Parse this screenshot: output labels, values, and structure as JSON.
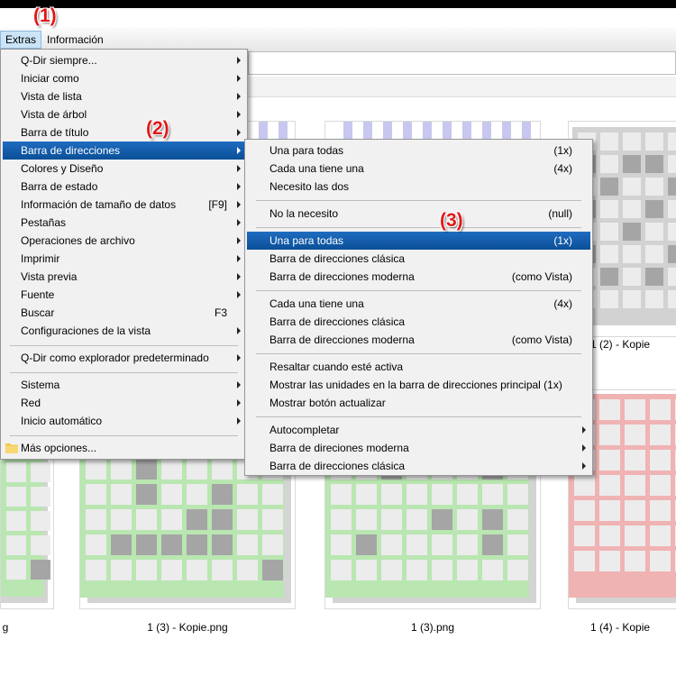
{
  "menubar": {
    "items": [
      {
        "label": "Extras"
      },
      {
        "label": "Información"
      }
    ]
  },
  "annotations": {
    "a1": "(1)",
    "a2": "(2)",
    "a3": "(3)"
  },
  "extras_menu": {
    "items": [
      {
        "label": "Q-Dir siempre...",
        "submenu": true
      },
      {
        "label": "Iniciar como",
        "submenu": true
      },
      {
        "label": "Vista de lista",
        "submenu": true
      },
      {
        "label": "Vista de árbol",
        "submenu": true
      },
      {
        "label": "Barra de título",
        "submenu": true
      },
      {
        "label": "Barra de direcciones",
        "submenu": true,
        "highlighted": true
      },
      {
        "label": "Colores y Diseño",
        "submenu": true
      },
      {
        "label": "Barra de estado",
        "submenu": true
      },
      {
        "label": "Información de tamaño de datos",
        "shortcut": "[F9]",
        "submenu": true
      },
      {
        "label": "Pestañas",
        "submenu": true
      },
      {
        "label": "Operaciones de archivo",
        "submenu": true
      },
      {
        "label": "Imprimir",
        "submenu": true
      },
      {
        "label": "Vista previa",
        "submenu": true
      },
      {
        "label": "Fuente",
        "submenu": true
      },
      {
        "label": "Buscar",
        "shortcut": "F3"
      },
      {
        "label": "Configuraciones de la vista",
        "submenu": true
      },
      {
        "label": "Q-Dir como explorador predeterminado",
        "submenu": true
      },
      {
        "label": "Sistema",
        "submenu": true
      },
      {
        "label": "Red",
        "submenu": true
      },
      {
        "label": "Inicio automático",
        "submenu": true
      },
      {
        "label": "Más opciones...",
        "icon": "folder-icon"
      }
    ]
  },
  "address_submenu": {
    "items": [
      {
        "label": "Una para todas",
        "shortcut": "(1x)"
      },
      {
        "label": "Cada una tiene una",
        "shortcut": "(4x)"
      },
      {
        "label": "Necesito las dos"
      },
      {
        "label": "No la necesito",
        "shortcut": "(null)"
      },
      {
        "label": "Una para todas",
        "shortcut": "(1x)",
        "highlighted": true
      },
      {
        "label": "Barra de direcciones clásica"
      },
      {
        "label": "Barra de direcciones moderna",
        "shortcut": "(como Vista)"
      },
      {
        "label": "Cada una tiene una",
        "shortcut": "(4x)"
      },
      {
        "label": "Barra de direcciones clásica"
      },
      {
        "label": "Barra de direcciones moderna",
        "shortcut": "(como Vista)"
      },
      {
        "label": "Resaltar cuando esté activa"
      },
      {
        "label": "Mostrar las unidades en la barra de direcciones principal (1x)"
      },
      {
        "label": "Mostrar botón actualizar"
      },
      {
        "label": "Autocompletar",
        "submenu": true
      },
      {
        "label": "Barra de direciones moderna",
        "submenu": true
      },
      {
        "label": "Barra de direcciones clásica",
        "submenu": true
      }
    ]
  },
  "files": {
    "captions": [
      "1 (2) - Kopie",
      "g",
      "1 (3) - Kopie.png",
      "1 (3).png",
      "1 (4) - Kopie"
    ]
  },
  "colors": {
    "highlight": "#0a4f97",
    "annotation": "#e01818",
    "green_frame": "#b9e6b1",
    "red_frame": "#f0b3b3",
    "gray_frame": "#c9c9c9",
    "cell_dark": "#a5a5a5",
    "cell_light": "#ececec"
  }
}
